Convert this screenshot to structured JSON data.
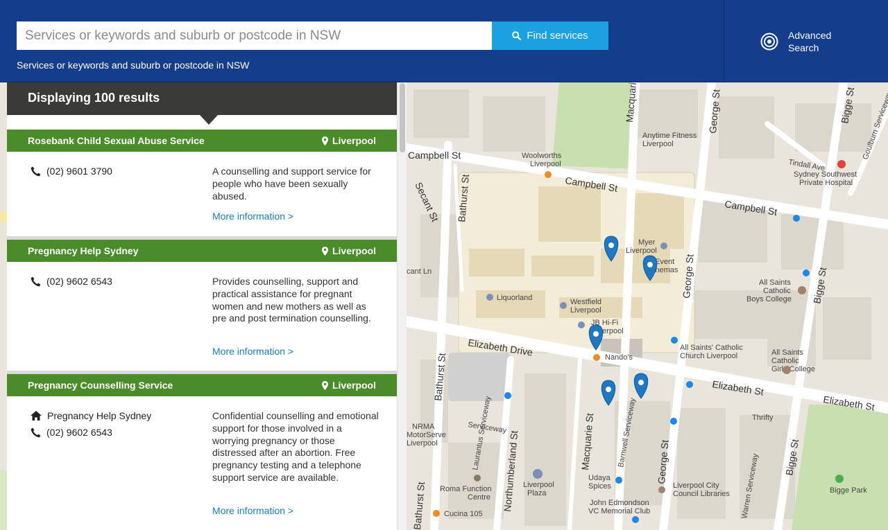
{
  "search": {
    "placeholder": "Services or keywords and suburb or postcode in NSW",
    "button_label": "Find services",
    "hint": "Services or keywords and suburb or postcode in NSW"
  },
  "advanced": {
    "line1": "Advanced",
    "line2": "Search"
  },
  "results": {
    "heading": "Displaying 100 results",
    "cards": [
      {
        "title": "Rosebank Child Sexual Abuse Service",
        "location": "Liverpool",
        "phone": "(02) 9601 3790",
        "description": "A counselling and support service for people who have been sexually abused.",
        "more": "More information >"
      },
      {
        "title": "Pregnancy Help Sydney",
        "location": "Liverpool",
        "phone": "(02) 9602 6543",
        "description": "Provides counselling, support and practical assistance for pregnant women and new mothers as well as pre and post termination counselling.",
        "more": "More information >"
      },
      {
        "title": "Pregnancy Counselling Service",
        "location": "Liverpool",
        "organisation": "Pregnancy Help Sydney",
        "phone": "(02) 9602 6543",
        "description": "Confidential counselling and emotional support for those involved in a worrying pregnancy or those distressed after an abortion. Free pregnancy testing and a telephone support service are available.",
        "more": "More information >"
      }
    ]
  },
  "map": {
    "streets": [
      "Campbell St",
      "Campbell St",
      "Campbell St",
      "Macquarie St",
      "George St",
      "Bigge St",
      "Elizabeth Drive",
      "Elizabeth St",
      "Elizabeth St",
      "Bathurst St",
      "Bathurst St",
      "Northumberland St",
      "Macquarie St",
      "George St",
      "Bigge St",
      "Secant St",
      "Tindall Ave",
      "Goulburn Serviceway",
      "Warren Serviceway",
      "Laurantus Serviceway",
      "Serviceway",
      "Barnwell Serviceway",
      "Bigge St",
      "Macquarie St",
      "Elizabeth St",
      "cant Ln",
      "Bathurst St",
      "Bigge St"
    ],
    "places": [
      "Anytime Fitness Liverpool",
      "Woolworths Liverpool",
      "Sydney Southwest Private Hospital",
      "Myer Liverpool",
      "Event Cinemas",
      "Liquorland",
      "Westfield Liverpool",
      "JB Hi-Fi Liverpool",
      "Nando's",
      "All Saints Catholic Boys College",
      "All Saints' Catholic Church Liverpool",
      "All Saints Catholic Girls College",
      "Thrifty",
      "NRMA MotorServe Liverpool",
      "Roma Function Centre",
      "Liverpool Plaza",
      "Cucina 105",
      "Udaya Spices",
      "John Edmondson VC Memorial Club",
      "Liverpool City Council Libraries",
      "Bigge Park"
    ],
    "colors": {
      "land": "#e9e5dc",
      "road": "#ffffff",
      "park": "#c8dfb0",
      "mall": "#f3ecd9",
      "pin": "#1f78c1"
    }
  }
}
